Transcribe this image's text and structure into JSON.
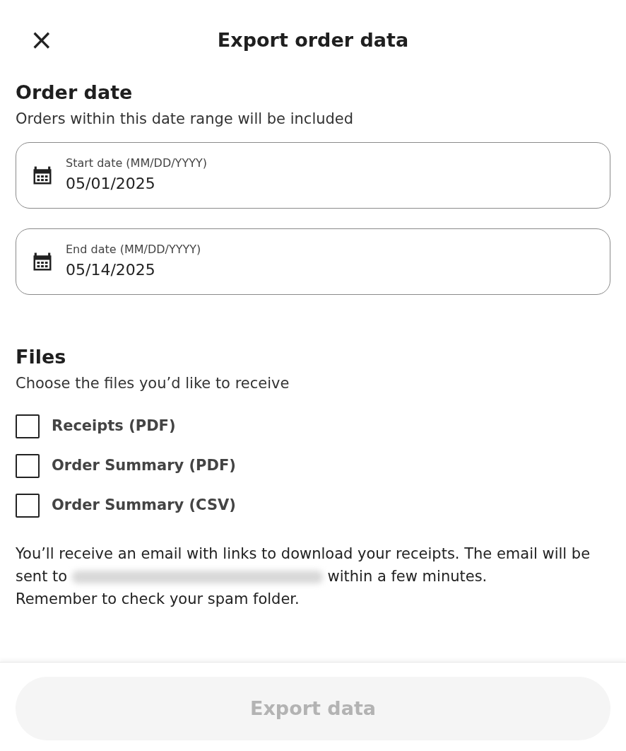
{
  "header": {
    "close_icon": "×",
    "title": "Export order data"
  },
  "order_date": {
    "heading": "Order date",
    "description": "Orders within this date range will be included",
    "fields": [
      {
        "label": "Start date (MM/DD/YYYY)",
        "value": "05/01/2025"
      },
      {
        "label": "End date (MM/DD/YYYY)",
        "value": "05/14/2025"
      }
    ]
  },
  "files": {
    "heading": "Files",
    "description": "Choose the files you’d like to receive",
    "options": [
      {
        "label": "Receipts (PDF)",
        "checked": false
      },
      {
        "label": "Order Summary (PDF)",
        "checked": false
      },
      {
        "label": "Order Summary (CSV)",
        "checked": false
      }
    ]
  },
  "notice": {
    "before": "You’ll receive an email with links to download your receipts. The email will be sent to",
    "after": "within a few minutes.",
    "line_3": "Remember to check your spam folder."
  },
  "footer": {
    "button": {
      "label": "Export data",
      "disabled": true
    }
  }
}
